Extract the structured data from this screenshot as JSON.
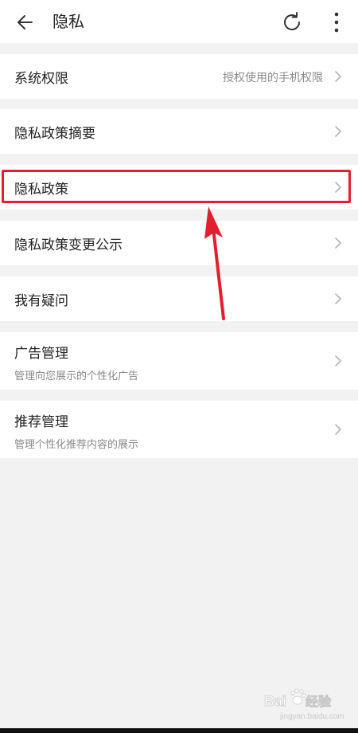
{
  "header": {
    "title": "隐私",
    "back_icon": "arrow-left-icon",
    "refresh_icon": "refresh-icon",
    "more_icon": "more-vertical-icon"
  },
  "items": [
    {
      "title": "系统权限",
      "value": "授权使用的手机权限"
    },
    {
      "title": "隐私政策摘要"
    },
    {
      "title": "隐私政策",
      "highlighted": true
    },
    {
      "title": "隐私政策变更公示"
    },
    {
      "title": "我有疑问"
    },
    {
      "title": "广告管理",
      "subtitle": "管理向您展示的个性化广告"
    },
    {
      "title": "推荐管理",
      "subtitle": "管理个性化推荐内容的展示"
    }
  ],
  "annotation": {
    "color": "#e0202e"
  },
  "watermark": {
    "text": "Baidu 经验",
    "subtext": "jingyan.baidu.com"
  }
}
